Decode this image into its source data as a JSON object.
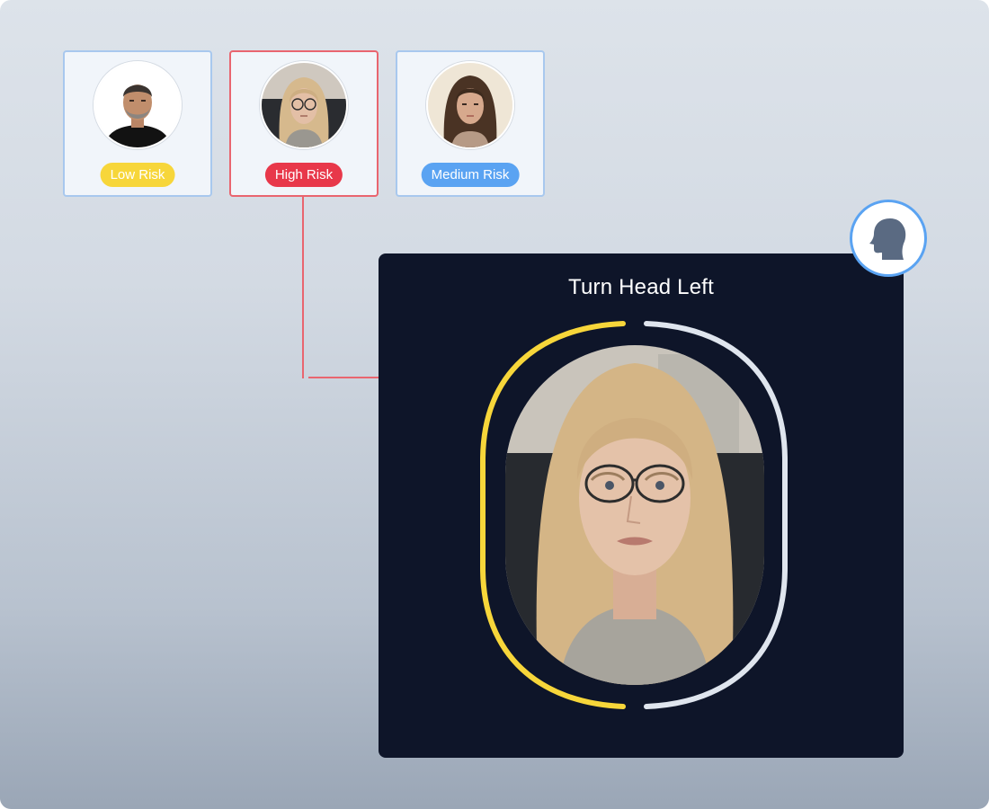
{
  "profiles": [
    {
      "risk_label": "Low Risk",
      "risk_color": "#f7d63a",
      "avatar_icon": "man-portrait"
    },
    {
      "risk_label": "High Risk",
      "risk_color": "#e8384a",
      "avatar_icon": "woman-glasses-portrait"
    },
    {
      "risk_label": "Medium Risk",
      "risk_color": "#5aa3f2",
      "avatar_icon": "woman-portrait"
    }
  ],
  "liveness": {
    "instruction": "Turn Head Left",
    "progress_color": "#f7d63a",
    "remaining_color": "#dfe5ee",
    "head_icon": "head-profile-icon"
  },
  "colors": {
    "panel_background": "#0e1529",
    "connector": "#e9656f",
    "card_border": "#a8c8ee"
  }
}
